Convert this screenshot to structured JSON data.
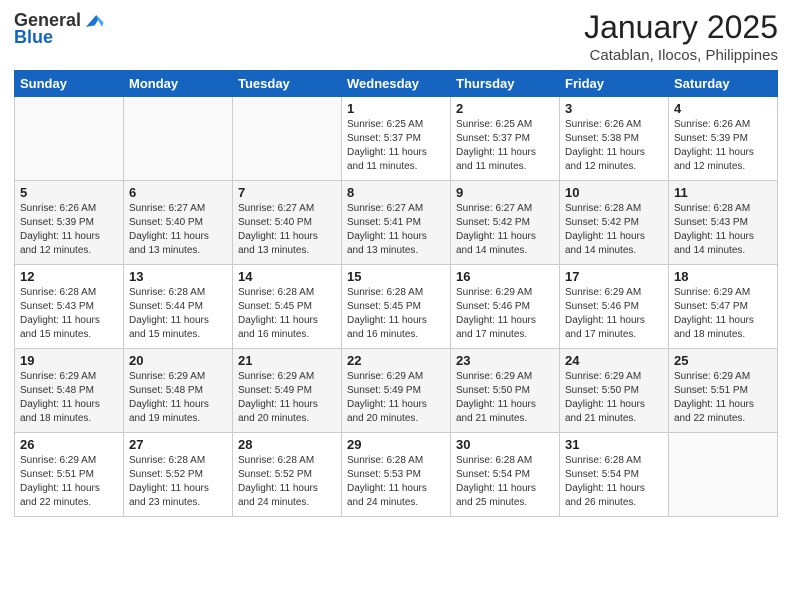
{
  "header": {
    "logo_general": "General",
    "logo_blue": "Blue",
    "month_title": "January 2025",
    "location": "Catablan, Ilocos, Philippines"
  },
  "days_of_week": [
    "Sunday",
    "Monday",
    "Tuesday",
    "Wednesday",
    "Thursday",
    "Friday",
    "Saturday"
  ],
  "weeks": [
    [
      {
        "day": "",
        "sunrise": "",
        "sunset": "",
        "daylight": ""
      },
      {
        "day": "",
        "sunrise": "",
        "sunset": "",
        "daylight": ""
      },
      {
        "day": "",
        "sunrise": "",
        "sunset": "",
        "daylight": ""
      },
      {
        "day": "1",
        "sunrise": "Sunrise: 6:25 AM",
        "sunset": "Sunset: 5:37 PM",
        "daylight": "Daylight: 11 hours and 11 minutes."
      },
      {
        "day": "2",
        "sunrise": "Sunrise: 6:25 AM",
        "sunset": "Sunset: 5:37 PM",
        "daylight": "Daylight: 11 hours and 11 minutes."
      },
      {
        "day": "3",
        "sunrise": "Sunrise: 6:26 AM",
        "sunset": "Sunset: 5:38 PM",
        "daylight": "Daylight: 11 hours and 12 minutes."
      },
      {
        "day": "4",
        "sunrise": "Sunrise: 6:26 AM",
        "sunset": "Sunset: 5:39 PM",
        "daylight": "Daylight: 11 hours and 12 minutes."
      }
    ],
    [
      {
        "day": "5",
        "sunrise": "Sunrise: 6:26 AM",
        "sunset": "Sunset: 5:39 PM",
        "daylight": "Daylight: 11 hours and 12 minutes."
      },
      {
        "day": "6",
        "sunrise": "Sunrise: 6:27 AM",
        "sunset": "Sunset: 5:40 PM",
        "daylight": "Daylight: 11 hours and 13 minutes."
      },
      {
        "day": "7",
        "sunrise": "Sunrise: 6:27 AM",
        "sunset": "Sunset: 5:40 PM",
        "daylight": "Daylight: 11 hours and 13 minutes."
      },
      {
        "day": "8",
        "sunrise": "Sunrise: 6:27 AM",
        "sunset": "Sunset: 5:41 PM",
        "daylight": "Daylight: 11 hours and 13 minutes."
      },
      {
        "day": "9",
        "sunrise": "Sunrise: 6:27 AM",
        "sunset": "Sunset: 5:42 PM",
        "daylight": "Daylight: 11 hours and 14 minutes."
      },
      {
        "day": "10",
        "sunrise": "Sunrise: 6:28 AM",
        "sunset": "Sunset: 5:42 PM",
        "daylight": "Daylight: 11 hours and 14 minutes."
      },
      {
        "day": "11",
        "sunrise": "Sunrise: 6:28 AM",
        "sunset": "Sunset: 5:43 PM",
        "daylight": "Daylight: 11 hours and 14 minutes."
      }
    ],
    [
      {
        "day": "12",
        "sunrise": "Sunrise: 6:28 AM",
        "sunset": "Sunset: 5:43 PM",
        "daylight": "Daylight: 11 hours and 15 minutes."
      },
      {
        "day": "13",
        "sunrise": "Sunrise: 6:28 AM",
        "sunset": "Sunset: 5:44 PM",
        "daylight": "Daylight: 11 hours and 15 minutes."
      },
      {
        "day": "14",
        "sunrise": "Sunrise: 6:28 AM",
        "sunset": "Sunset: 5:45 PM",
        "daylight": "Daylight: 11 hours and 16 minutes."
      },
      {
        "day": "15",
        "sunrise": "Sunrise: 6:28 AM",
        "sunset": "Sunset: 5:45 PM",
        "daylight": "Daylight: 11 hours and 16 minutes."
      },
      {
        "day": "16",
        "sunrise": "Sunrise: 6:29 AM",
        "sunset": "Sunset: 5:46 PM",
        "daylight": "Daylight: 11 hours and 17 minutes."
      },
      {
        "day": "17",
        "sunrise": "Sunrise: 6:29 AM",
        "sunset": "Sunset: 5:46 PM",
        "daylight": "Daylight: 11 hours and 17 minutes."
      },
      {
        "day": "18",
        "sunrise": "Sunrise: 6:29 AM",
        "sunset": "Sunset: 5:47 PM",
        "daylight": "Daylight: 11 hours and 18 minutes."
      }
    ],
    [
      {
        "day": "19",
        "sunrise": "Sunrise: 6:29 AM",
        "sunset": "Sunset: 5:48 PM",
        "daylight": "Daylight: 11 hours and 18 minutes."
      },
      {
        "day": "20",
        "sunrise": "Sunrise: 6:29 AM",
        "sunset": "Sunset: 5:48 PM",
        "daylight": "Daylight: 11 hours and 19 minutes."
      },
      {
        "day": "21",
        "sunrise": "Sunrise: 6:29 AM",
        "sunset": "Sunset: 5:49 PM",
        "daylight": "Daylight: 11 hours and 20 minutes."
      },
      {
        "day": "22",
        "sunrise": "Sunrise: 6:29 AM",
        "sunset": "Sunset: 5:49 PM",
        "daylight": "Daylight: 11 hours and 20 minutes."
      },
      {
        "day": "23",
        "sunrise": "Sunrise: 6:29 AM",
        "sunset": "Sunset: 5:50 PM",
        "daylight": "Daylight: 11 hours and 21 minutes."
      },
      {
        "day": "24",
        "sunrise": "Sunrise: 6:29 AM",
        "sunset": "Sunset: 5:50 PM",
        "daylight": "Daylight: 11 hours and 21 minutes."
      },
      {
        "day": "25",
        "sunrise": "Sunrise: 6:29 AM",
        "sunset": "Sunset: 5:51 PM",
        "daylight": "Daylight: 11 hours and 22 minutes."
      }
    ],
    [
      {
        "day": "26",
        "sunrise": "Sunrise: 6:29 AM",
        "sunset": "Sunset: 5:51 PM",
        "daylight": "Daylight: 11 hours and 22 minutes."
      },
      {
        "day": "27",
        "sunrise": "Sunrise: 6:28 AM",
        "sunset": "Sunset: 5:52 PM",
        "daylight": "Daylight: 11 hours and 23 minutes."
      },
      {
        "day": "28",
        "sunrise": "Sunrise: 6:28 AM",
        "sunset": "Sunset: 5:52 PM",
        "daylight": "Daylight: 11 hours and 24 minutes."
      },
      {
        "day": "29",
        "sunrise": "Sunrise: 6:28 AM",
        "sunset": "Sunset: 5:53 PM",
        "daylight": "Daylight: 11 hours and 24 minutes."
      },
      {
        "day": "30",
        "sunrise": "Sunrise: 6:28 AM",
        "sunset": "Sunset: 5:54 PM",
        "daylight": "Daylight: 11 hours and 25 minutes."
      },
      {
        "day": "31",
        "sunrise": "Sunrise: 6:28 AM",
        "sunset": "Sunset: 5:54 PM",
        "daylight": "Daylight: 11 hours and 26 minutes."
      },
      {
        "day": "",
        "sunrise": "",
        "sunset": "",
        "daylight": ""
      }
    ]
  ]
}
